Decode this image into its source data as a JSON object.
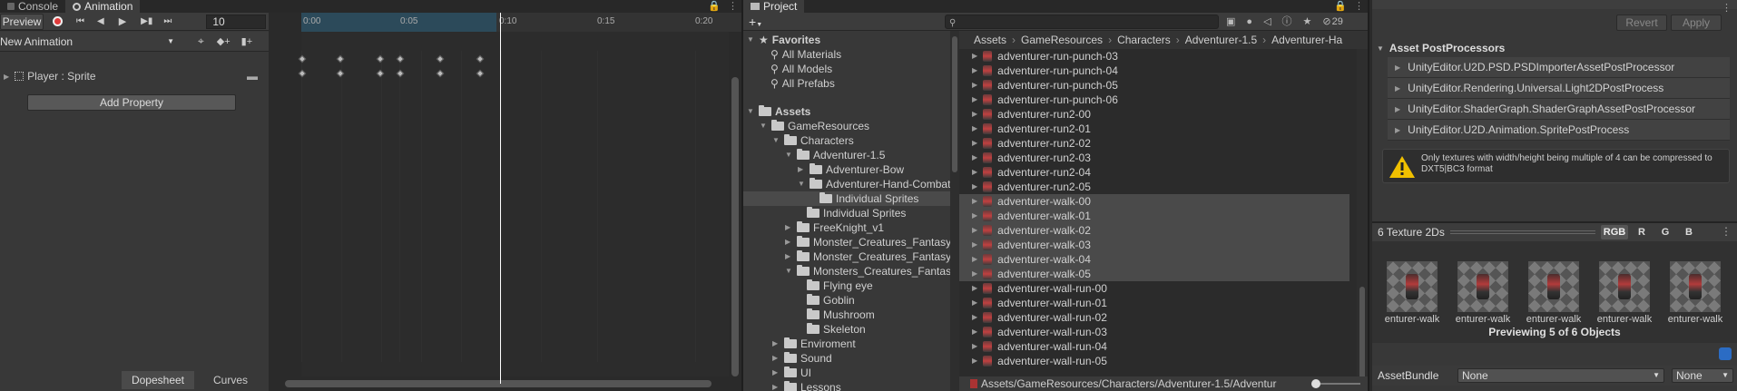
{
  "animation_window": {
    "tabs": [
      "Console",
      "Animation"
    ],
    "preview_label": "Preview",
    "frame_value": "10",
    "clip_name": "New Animation",
    "property_label": "Player : Sprite",
    "add_property_label": "Add Property",
    "ruler_labels": [
      "0:00",
      "0:05",
      "0:10",
      "0:15",
      "0:20"
    ],
    "bottom_tabs": [
      "Dopesheet",
      "Curves"
    ]
  },
  "project_window": {
    "tab": "Project",
    "count_badge": "29",
    "favorites": {
      "title": "Favorites",
      "items": [
        "All Materials",
        "All Models",
        "All Prefabs"
      ]
    },
    "tree": [
      {
        "label": "Assets"
      },
      {
        "label": "GameResources"
      },
      {
        "label": "Characters"
      },
      {
        "label": "Adventurer-1.5"
      },
      {
        "label": "Adventurer-Bow"
      },
      {
        "label": "Adventurer-Hand-Combat"
      },
      {
        "label": "Individual Sprites"
      },
      {
        "label": "Individual Sprites"
      },
      {
        "label": "FreeKnight_v1"
      },
      {
        "label": "Monster_Creatures_Fantasy("
      },
      {
        "label": "Monster_Creatures_Fantasy("
      },
      {
        "label": "Monsters_Creatures_Fantasy"
      },
      {
        "label": "Flying eye"
      },
      {
        "label": "Goblin"
      },
      {
        "label": "Mushroom"
      },
      {
        "label": "Skeleton"
      },
      {
        "label": "Enviroment"
      },
      {
        "label": "Sound"
      },
      {
        "label": "UI"
      },
      {
        "label": "Lessons"
      }
    ],
    "breadcrumb": [
      "Assets",
      "GameResources",
      "Characters",
      "Adventurer-1.5",
      "Adventurer-Ha"
    ],
    "files": [
      "adventurer-run-punch-03",
      "adventurer-run-punch-04",
      "adventurer-run-punch-05",
      "adventurer-run-punch-06",
      "adventurer-run2-00",
      "adventurer-run2-01",
      "adventurer-run2-02",
      "adventurer-run2-03",
      "adventurer-run2-04",
      "adventurer-run2-05",
      "adventurer-walk-00",
      "adventurer-walk-01",
      "adventurer-walk-02",
      "adventurer-walk-03",
      "adventurer-walk-04",
      "adventurer-walk-05",
      "adventurer-wall-run-00",
      "adventurer-wall-run-01",
      "adventurer-wall-run-02",
      "adventurer-wall-run-03",
      "adventurer-wall-run-04",
      "adventurer-wall-run-05"
    ],
    "path": "Assets/GameResources/Characters/Adventurer-1.5/Adventur"
  },
  "inspector": {
    "revert_label": "Revert",
    "apply_label": "Apply",
    "postprocessors_title": "Asset PostProcessors",
    "postprocessors": [
      "UnityEditor.U2D.PSD.PSDImporterAssetPostProcessor",
      "UnityEditor.Rendering.Universal.Light2DPostProcess",
      "UnityEditor.ShaderGraph.ShaderGraphAssetPostProcessor",
      "UnityEditor.U2D.Animation.SpritePostProcess"
    ],
    "warning": "Only textures with width/height being multiple of 4 can be compressed to DXT5|BC3 format",
    "preview_title": "6 Texture 2Ds",
    "channels": [
      "RGB",
      "R",
      "G",
      "B"
    ],
    "thumb_label": "enturer-walk",
    "preview_status": "Previewing 5 of 6 Objects",
    "assetbundle_label": "AssetBundle",
    "assetbundle_value": "None",
    "variant_value": "None"
  },
  "colors": {
    "accent": "#2c4a5a",
    "selection": "#4a4a4a",
    "warning": "#f0c000"
  }
}
